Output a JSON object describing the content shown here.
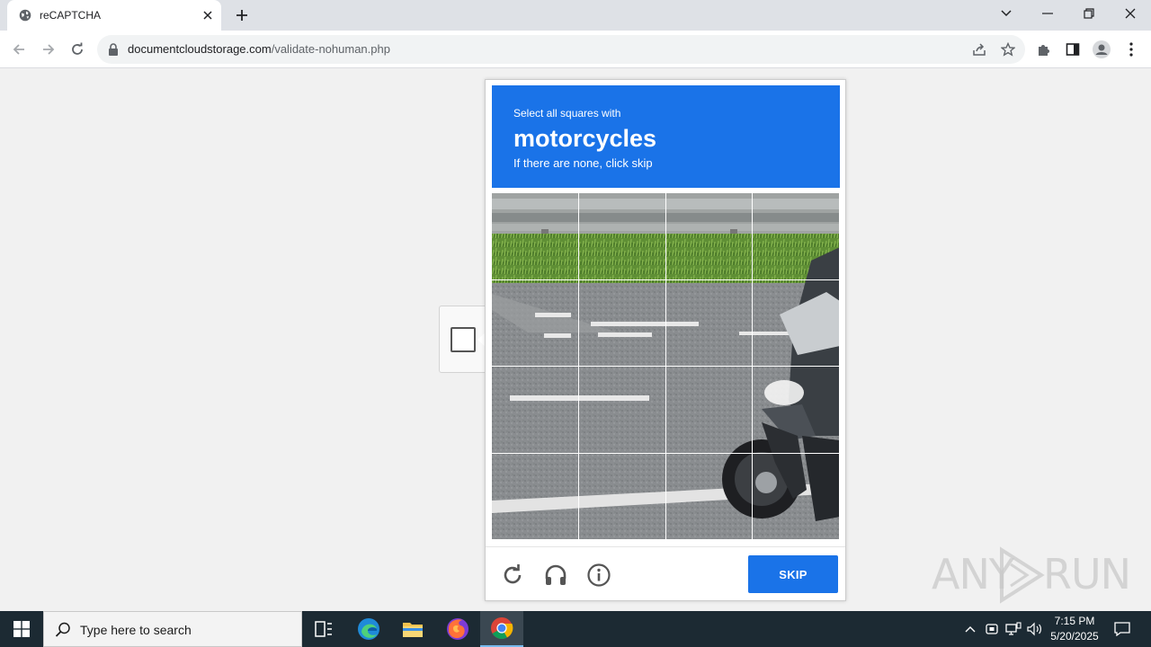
{
  "browser": {
    "tab_title": "reCAPTCHA",
    "url_domain": "documentcloudstorage.com",
    "url_path": "/validate-nohuman.php"
  },
  "captcha": {
    "prompt_line1": "Select all squares with",
    "prompt_object": "motorcycles",
    "prompt_line3": "If there are none, click skip",
    "grid_rows": 4,
    "grid_cols": 4,
    "skip_label": "SKIP",
    "accent_color": "#1a73e8"
  },
  "watermark": {
    "text_left": "ANY",
    "text_right": "RUN"
  },
  "taskbar": {
    "search_placeholder": "Type here to search",
    "time": "7:15 PM",
    "date": "5/20/2025"
  },
  "icons": {
    "footer": [
      "reload-icon",
      "headphones-icon",
      "info-icon"
    ],
    "taskbar_apps": [
      "task-view-icon",
      "edge-icon",
      "file-explorer-icon",
      "firefox-icon",
      "chrome-icon"
    ]
  }
}
